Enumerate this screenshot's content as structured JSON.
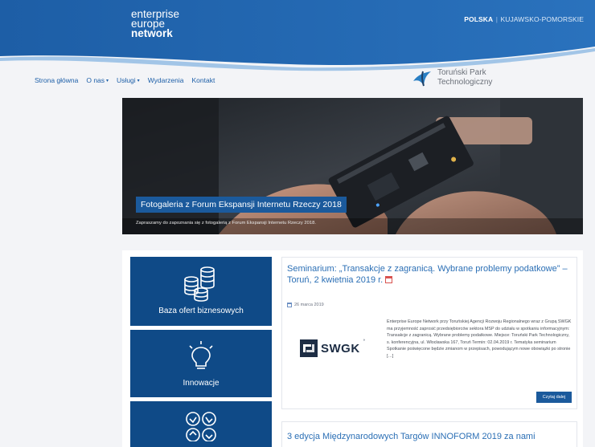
{
  "header": {
    "logo_line1": "enterprise",
    "logo_line2": "europe",
    "logo_line3": "network",
    "region_country": "POLSKA",
    "region_separator": "|",
    "region_name": "KUJAWSKO-POMORSKIE",
    "brand_color": "#1b5a9c"
  },
  "nav": {
    "items": [
      {
        "label": "Strona główna",
        "dropdown": false
      },
      {
        "label": "O nas",
        "dropdown": true
      },
      {
        "label": "Usługi",
        "dropdown": true
      },
      {
        "label": "Wydarzenia",
        "dropdown": false
      },
      {
        "label": "Kontakt",
        "dropdown": false
      }
    ],
    "caret": "▾"
  },
  "partner": {
    "name_line1": "Toruński Park",
    "name_line2": "Technologiczny"
  },
  "hero": {
    "title": "Fotogaleria z Forum Ekspansji Internetu Rzeczy 2018",
    "description": "Zapraszamy do zapoznania się z fotogalerią z Forum Ekspansji Internetu Rzeczy 2018."
  },
  "tiles": [
    {
      "label": "Baza ofert biznesowych",
      "icon": "coins-stack-icon"
    },
    {
      "label": "Innowacje",
      "icon": "lightbulb-icon"
    },
    {
      "label": "",
      "icon": "handshake-icon"
    }
  ],
  "news": [
    {
      "title": "Seminarium: „Transakcje z zagranicą. Wybrane problemy podatkowe” – Toruń, 2 kwietnia 2019 r.",
      "date": "26 marca 2019",
      "logo_text": "SWGK",
      "logo_mark": "°",
      "body": "Enterprise Europe Network przy Toruńskiej Agencji Rozwoju Regionalnego wraz z Grupą SWGK ma przyjemność zaprosić przedsiębiorców sektora MSP do udziału w spotkaniu informacyjnym: Transakcje z zagranicą. Wybrane problemy podatkowe. Miejsce: Toruński Park Technologiczny, s. konferencyjna, ul. Włocławska 167, Toruń Termin: 02.04.2019 r. Tematyka seminarium Spotkanie poświęcone będzie zmianom w przepisach, powodującym nowe obowiązki po stronie […]",
      "button": "Czytaj dalej"
    },
    {
      "title": "3 edycja Międzynarodowych Targów INNOFORM 2019 za nami"
    }
  ]
}
